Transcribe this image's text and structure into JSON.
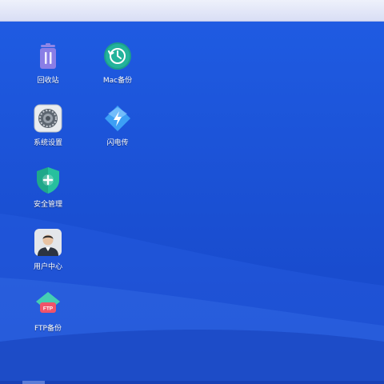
{
  "desktop": {
    "icons": [
      {
        "label": "回收站",
        "icon": "trash-icon"
      },
      {
        "label": "Mac备份",
        "icon": "time-machine-icon"
      },
      {
        "label": "系统设置",
        "icon": "gear-icon"
      },
      {
        "label": "闪电传",
        "icon": "lightning-transfer-icon"
      },
      {
        "label": "安全管理",
        "icon": "security-shield-icon"
      },
      {
        "label": "用户中心",
        "icon": "user-avatar-icon"
      },
      {
        "label": "FTP备份",
        "icon": "ftp-cloud-icon"
      }
    ]
  }
}
